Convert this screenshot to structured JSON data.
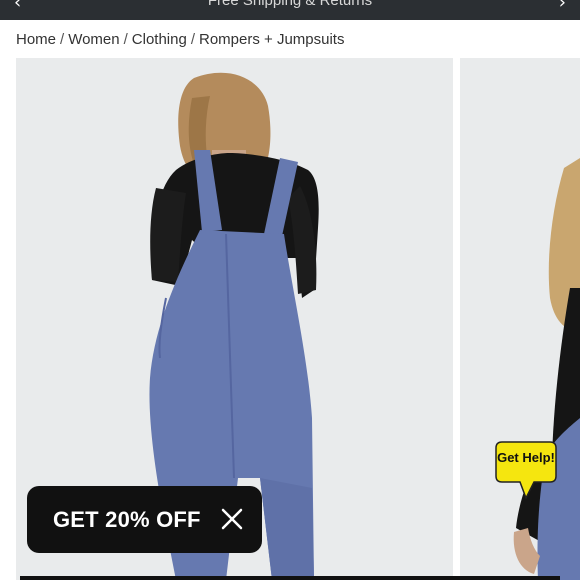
{
  "banner": {
    "promo_text": "Free Shipping & Returns",
    "prev_icon": "chevron-left-icon",
    "next_icon": "chevron-right-icon"
  },
  "breadcrumb": {
    "items": [
      "Home",
      "Women",
      "Clothing",
      "Rompers + Jumpsuits"
    ],
    "separator": "/"
  },
  "gallery": {
    "main_image": "overalls-back-view-image",
    "second_image": "overalls-side-view-image",
    "background": "#e9ebec",
    "overalls_color": "#6679b0",
    "top_color": "#151515"
  },
  "promo_popup": {
    "label": "GET 20% OFF",
    "close_icon": "close-icon"
  },
  "help_widget": {
    "label": "Get Help!",
    "color": "#f5e60f"
  }
}
